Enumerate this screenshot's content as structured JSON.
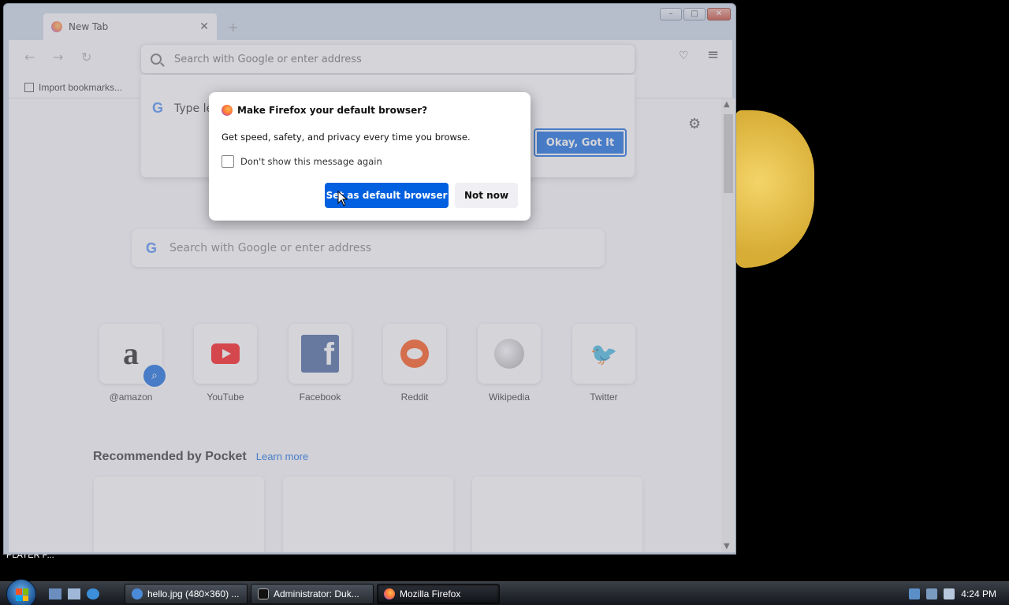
{
  "desktop": {
    "icon_label": "PLAYER P..."
  },
  "browser": {
    "tab": {
      "title": "New Tab",
      "close": "✕"
    },
    "new_tab": "+",
    "nav": {
      "back": "←",
      "forward": "→",
      "reload": "↻"
    },
    "urlbar": {
      "placeholder": "Search with Google or enter address"
    },
    "toolbar_icons": {
      "pocket": "♡",
      "menu": "≡"
    },
    "bookmarks": {
      "import_label": "Import bookmarks..."
    },
    "url_popup": {
      "type_text": "Type le",
      "button": "Okay, Got It"
    },
    "newtab_page": {
      "search_placeholder": "Search with Google or enter address",
      "top_sites": [
        {
          "label": "@amazon",
          "icon": "amazon-icon"
        },
        {
          "label": "YouTube",
          "icon": "youtube-icon"
        },
        {
          "label": "Facebook",
          "icon": "facebook-icon"
        },
        {
          "label": "Reddit",
          "icon": "reddit-icon"
        },
        {
          "label": "Wikipedia",
          "icon": "wikipedia-icon"
        },
        {
          "label": "Twitter",
          "icon": "twitter-icon"
        }
      ],
      "pocket_heading": "Recommended by Pocket",
      "learn_more": "Learn more"
    }
  },
  "dialog": {
    "title": "Make Firefox your default browser?",
    "message": "Get speed, safety, and privacy every time you browse.",
    "checkbox_label": "Don't show this message again",
    "primary_button": "Set as default browser",
    "secondary_button": "Not now"
  },
  "taskbar": {
    "items": [
      {
        "label": "hello.jpg (480×360) ..."
      },
      {
        "label": "Administrator:  Duk..."
      },
      {
        "label": "Mozilla Firefox"
      }
    ],
    "clock": "4:24 PM"
  },
  "colors": {
    "accent": "#0060df",
    "desktop": "#000000"
  }
}
